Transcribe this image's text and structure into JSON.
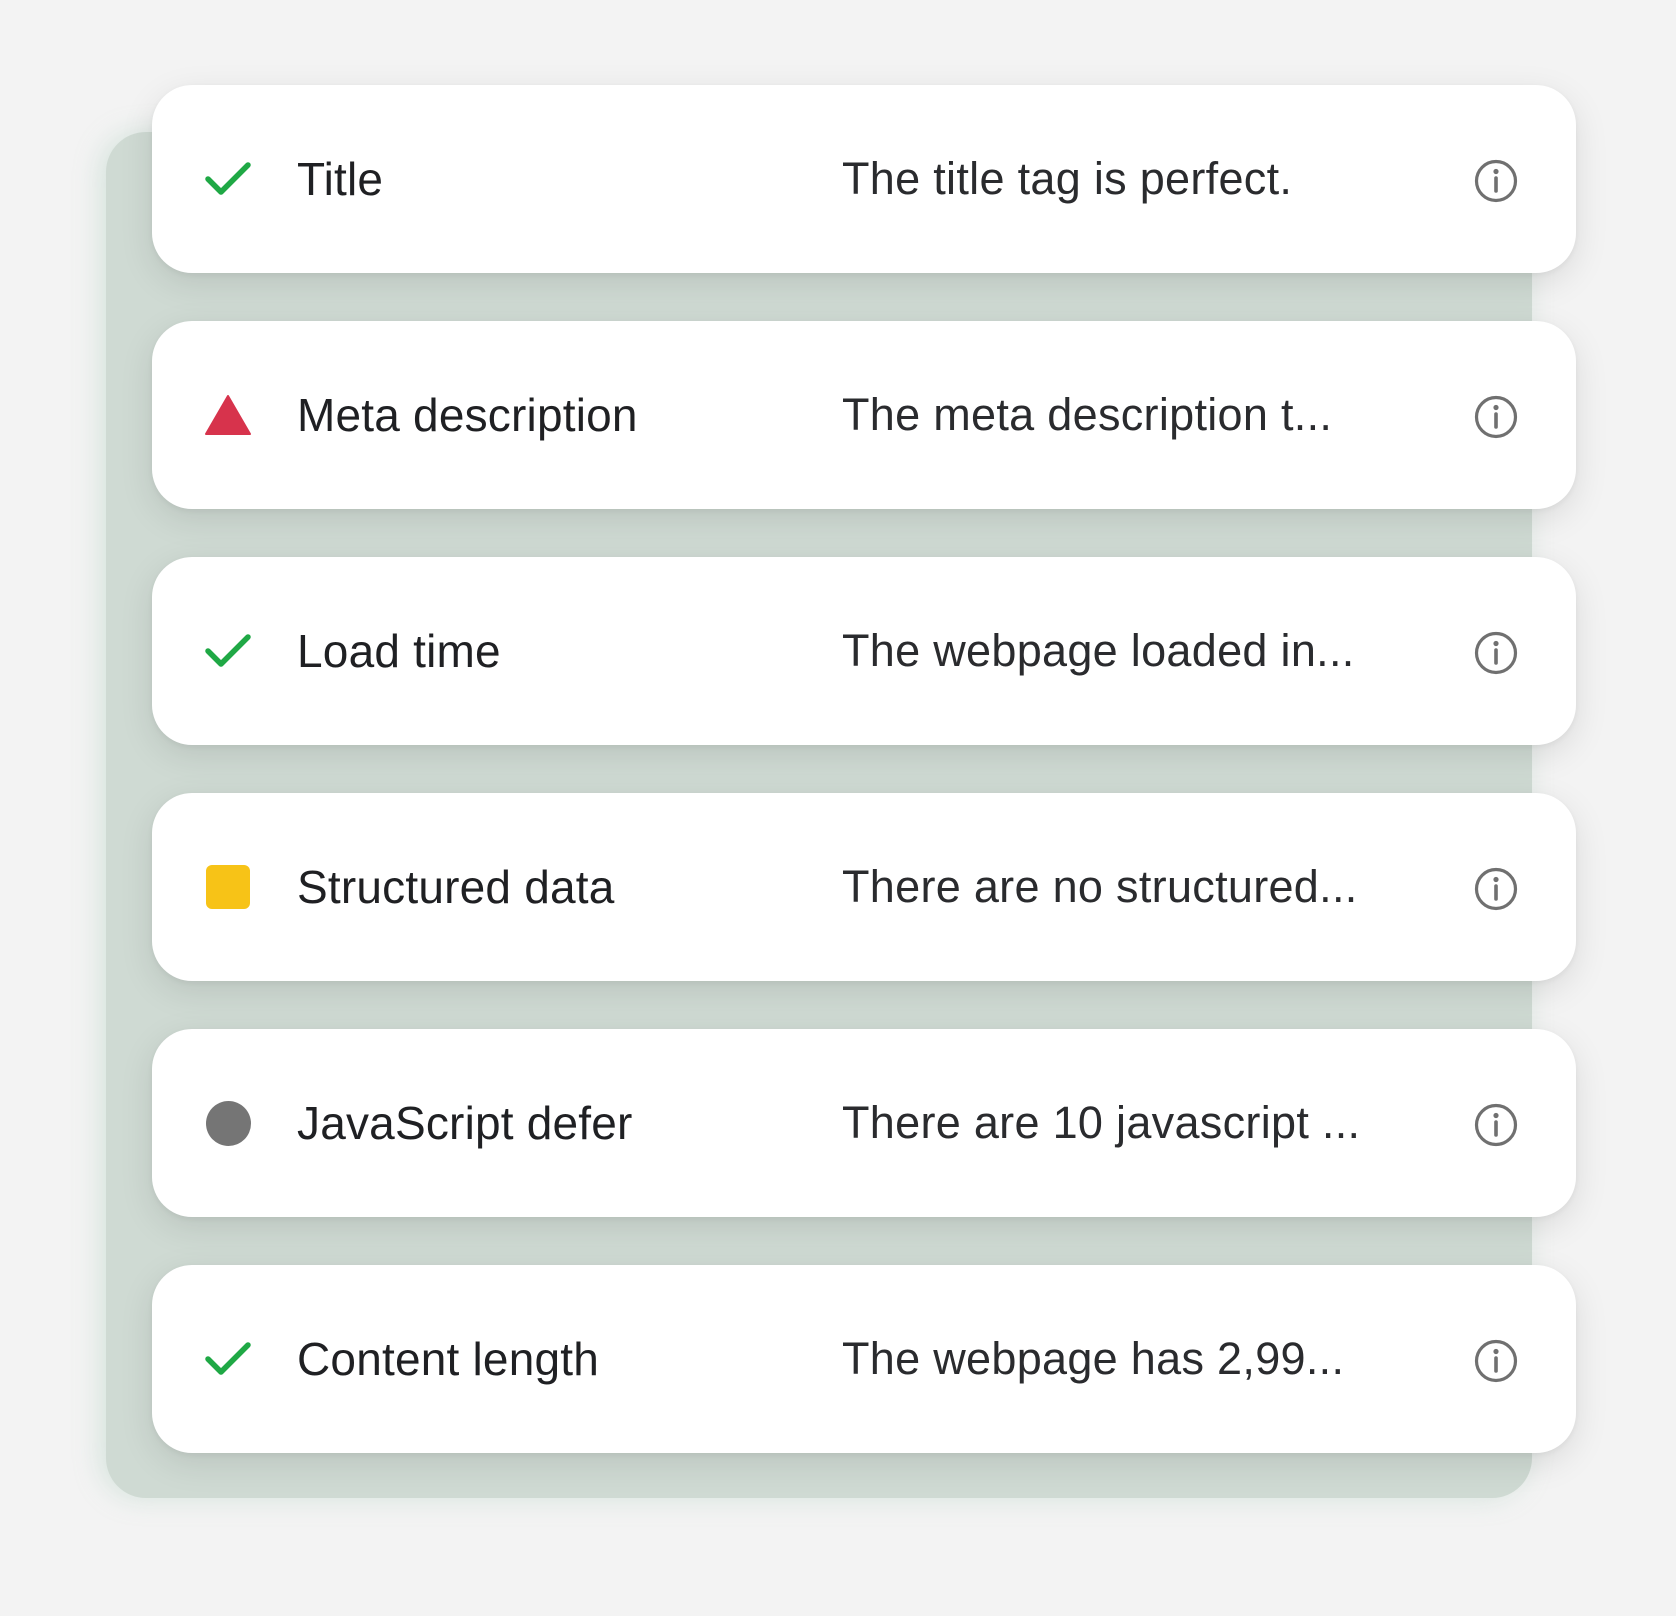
{
  "colors": {
    "pass": "#1fa845",
    "fail": "#d7334c",
    "warn": "#f7c317",
    "neutral": "#757575",
    "info_icon": "#707070"
  },
  "checks": [
    {
      "status": "pass",
      "status_icon": "checkmark-icon",
      "name": "Title",
      "result": "The title tag is perfect."
    },
    {
      "status": "fail",
      "status_icon": "warning-triangle-icon",
      "name": "Meta description",
      "result": "The meta description t..."
    },
    {
      "status": "pass",
      "status_icon": "checkmark-icon",
      "name": "Load time",
      "result": "The webpage loaded in..."
    },
    {
      "status": "warn",
      "status_icon": "square-icon",
      "name": "Structured data",
      "result": "There are no structured..."
    },
    {
      "status": "neutral",
      "status_icon": "circle-icon",
      "name": "JavaScript defer",
      "result": "There are 10 javascript ..."
    },
    {
      "status": "pass",
      "status_icon": "checkmark-icon",
      "name": "Content length",
      "result": "The webpage has 2,99..."
    }
  ],
  "info_icon": "info-circle-icon"
}
